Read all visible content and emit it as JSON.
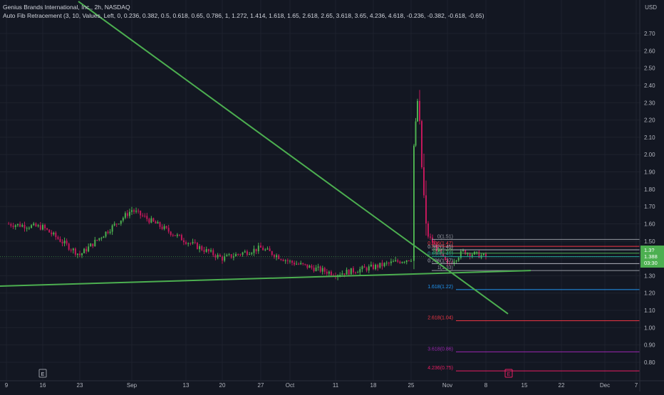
{
  "header": {
    "symbol_line": "Genius Brands International, Inc., 2h, NASDAQ",
    "indicator_line": "Auto Fib Retracement (3, 10, Values, Left, 0, 0.236, 0.382, 0.5, 0.618, 0.65, 0.786, 1, 1.272, 1.414, 1.618, 1.65, 2.618, 2.65, 3.618, 3.65, 4.236, 4.618, -0.236, -0.382, -0.618, -0.65)"
  },
  "currency": "USD",
  "colors": {
    "background": "#131722",
    "up": "#4caf50",
    "down": "#c2185b",
    "trendline": "#4caf50",
    "grid": "#1e222d"
  },
  "chart_data": {
    "type": "candlestick",
    "x_ticks": [
      "9",
      "16",
      "23",
      "Sep",
      "13",
      "20",
      "27",
      "Oct",
      "11",
      "18",
      "25",
      "Nov",
      "8",
      "15",
      "22",
      "Dec",
      "7"
    ],
    "y_ticks": [
      "0.80",
      "0.90",
      "1.00",
      "1.10",
      "1.20",
      "1.30",
      "1.40",
      "1.50",
      "1.60",
      "1.70",
      "1.80",
      "1.90",
      "2.00",
      "2.10",
      "2.20",
      "2.30",
      "2.40",
      "2.50",
      "2.60",
      "2.70"
    ],
    "ylim": [
      0.74,
      2.78
    ],
    "price_labels": [
      "1.3?",
      "1.388",
      "03:30"
    ],
    "event_markers": [
      "E",
      "E"
    ],
    "price_path": [
      {
        "x": "9",
        "y": 1.6
      },
      {
        "x": "16",
        "y": 1.58
      },
      {
        "x": "23",
        "y": 1.42
      },
      {
        "x": "Sep",
        "y": 1.68
      },
      {
        "x": "13",
        "y": 1.5
      },
      {
        "x": "20",
        "y": 1.4
      },
      {
        "x": "27",
        "y": 1.46
      },
      {
        "x": "Oct",
        "y": 1.38
      },
      {
        "x": "11",
        "y": 1.31
      },
      {
        "x": "18",
        "y": 1.35
      },
      {
        "x": "25",
        "y": 1.4
      },
      {
        "x": "25",
        "y": 2.05
      },
      {
        "x": "25",
        "y": 2.31
      },
      {
        "x": "25",
        "y": 1.55
      },
      {
        "x": "Nov",
        "y": 1.36
      },
      {
        "x": "Nov",
        "y": 1.44
      },
      {
        "x": "8",
        "y": 1.41
      }
    ],
    "fib_levels": [
      {
        "label": "0(1.51)",
        "value": 1.51,
        "color": "#9598a1"
      },
      {
        "label": "0.236(1.47)",
        "value": 1.47,
        "color": "#f23645"
      },
      {
        "label": "0.382(1.45)",
        "value": 1.45,
        "color": "#b2b5be"
      },
      {
        "label": "0.5(1.43)",
        "value": 1.43,
        "color": "#4caf50"
      },
      {
        "label": "0.618(1.41)",
        "value": 1.41,
        "color": "#26a69a"
      },
      {
        "label": "0.786(1.37)",
        "value": 1.37,
        "color": "#b2b5be"
      },
      {
        "label": "1(1.33)",
        "value": 1.33,
        "color": "#9598a1"
      },
      {
        "label": "1.618(1.22)",
        "value": 1.22,
        "color": "#2196f3"
      },
      {
        "label": "2.618(1.04)",
        "value": 1.04,
        "color": "#f23645"
      },
      {
        "label": "3.618(0.86)",
        "value": 0.86,
        "color": "#9c27b0"
      },
      {
        "label": "4.236(0.75)",
        "value": 0.75,
        "color": "#e91e63"
      }
    ],
    "trendlines": [
      {
        "from": {
          "x": "9",
          "y": 1.24
        },
        "to": {
          "x": "Nov",
          "y": 1.33
        }
      },
      {
        "from": {
          "x": "9",
          "y": 2.85
        },
        "to": {
          "x": "8",
          "y": 1.08
        }
      }
    ]
  }
}
